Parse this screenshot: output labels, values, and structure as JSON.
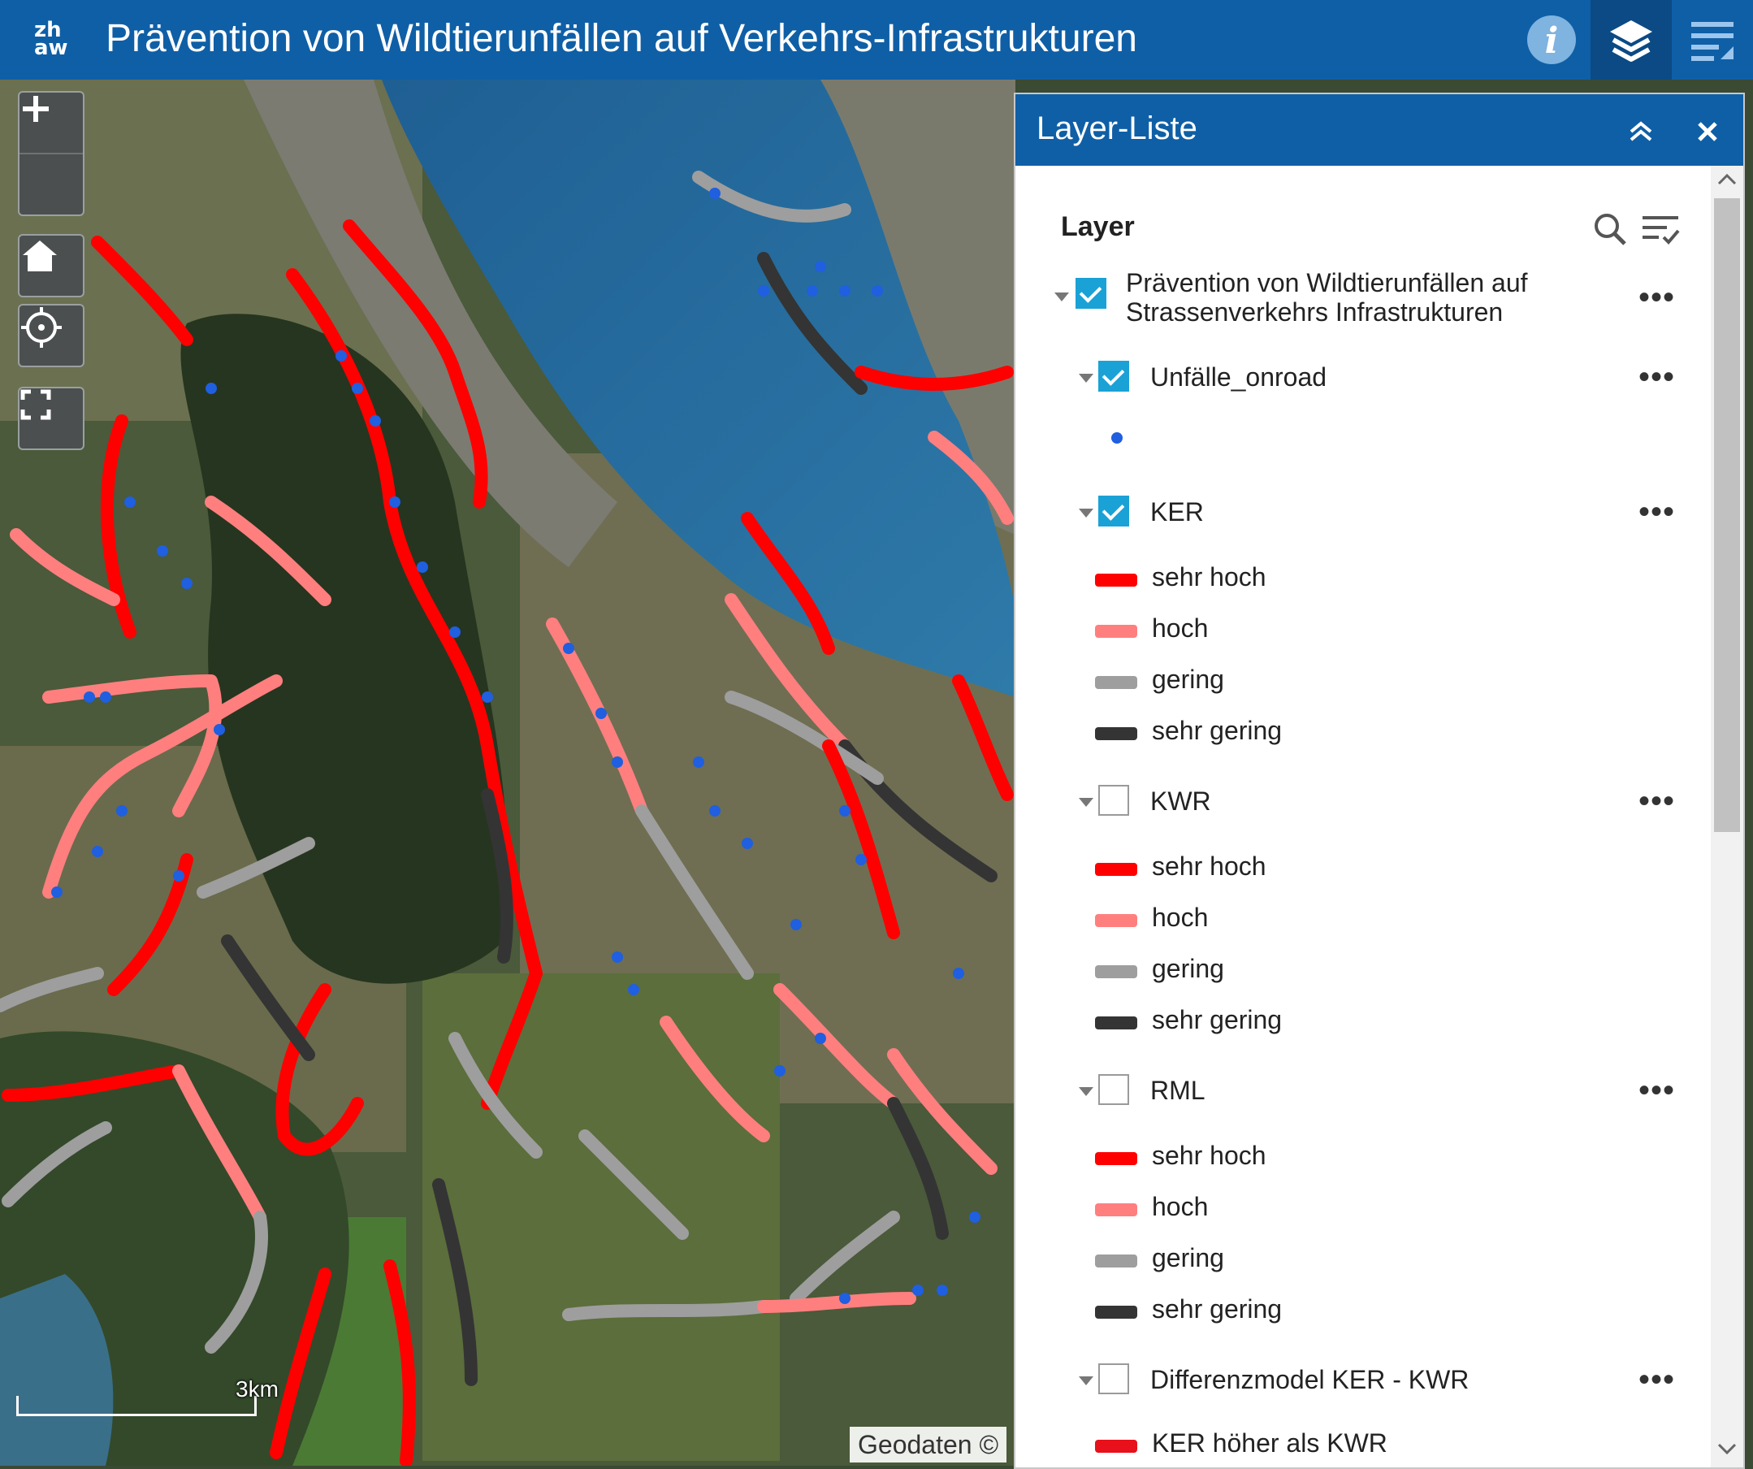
{
  "header": {
    "logo": "zh\naw",
    "title": "Prävention von Wildtierunfällen auf Verkehrs-Infrastrukturen"
  },
  "map": {
    "scale_label": "3km",
    "attribution": "Geodaten ©"
  },
  "panel": {
    "title": "Layer-Liste",
    "heading": "Layer",
    "more_label": "•••",
    "root": {
      "name_line1": "Prävention von Wildtierunfällen auf",
      "name_line2": "Strassenverkehrs Infrastrukturen",
      "checked": true
    },
    "unfaelle": {
      "name": "Unfälle_onroad",
      "checked": true
    },
    "ker": {
      "name": "KER",
      "checked": true,
      "legend": [
        "sehr hoch",
        "hoch",
        "gering",
        "sehr gering"
      ]
    },
    "kwr": {
      "name": "KWR",
      "checked": false,
      "legend": [
        "sehr hoch",
        "hoch",
        "gering",
        "sehr gering"
      ]
    },
    "rml": {
      "name": "RML",
      "checked": false,
      "legend": [
        "sehr hoch",
        "hoch",
        "gering",
        "sehr gering"
      ]
    },
    "diff": {
      "name": "Differenzmodel KER - KWR",
      "checked": false,
      "legend": [
        "KER höher als KWR"
      ]
    }
  },
  "colors": {
    "header": "#0f5fa6",
    "sehr_hoch": "#ff0000",
    "hoch": "#ff7f7f",
    "gering": "#9e9e9e",
    "sehr_gering": "#343434",
    "accident_point": "#1f5fe0",
    "checkbox": "#1aa2d6"
  },
  "icons": {
    "info": "info-icon",
    "layers": "layers-icon",
    "legend": "legend-list-icon",
    "collapse": "double-chevron-up-icon",
    "close": "close-icon",
    "search": "search-icon",
    "filter": "filter-list-icon"
  }
}
